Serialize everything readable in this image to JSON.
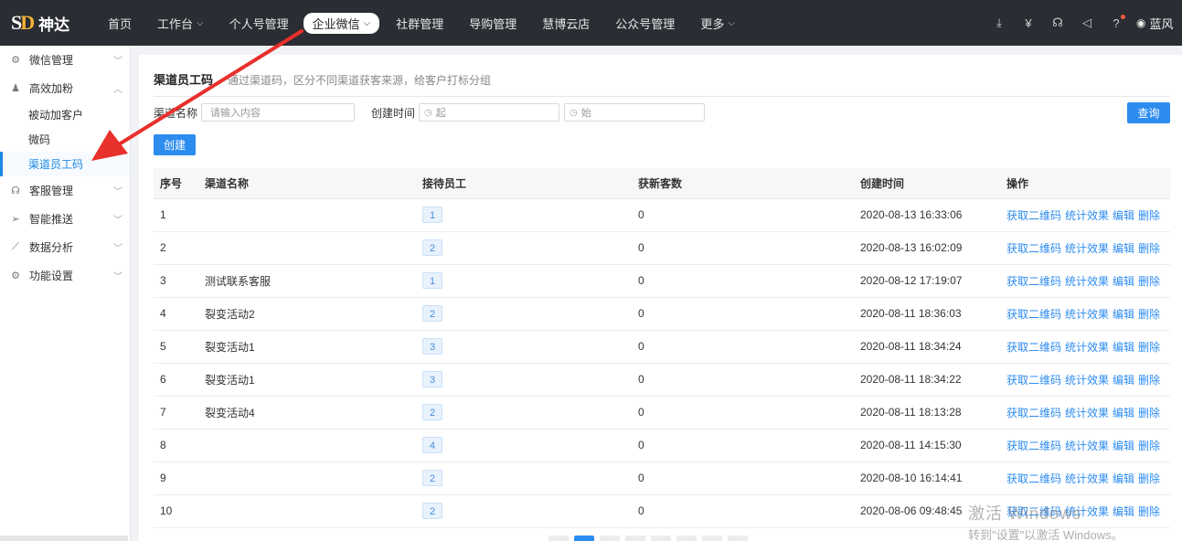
{
  "brand": {
    "mark_s": "S",
    "mark_d": "D",
    "name": "神达"
  },
  "nav": [
    {
      "label": "首页",
      "has_menu": false,
      "active": false
    },
    {
      "label": "工作台",
      "has_menu": true,
      "active": false
    },
    {
      "label": "个人号管理",
      "has_menu": false,
      "active": false
    },
    {
      "label": "企业微信",
      "has_menu": true,
      "active": true
    },
    {
      "label": "社群管理",
      "has_menu": false,
      "active": false
    },
    {
      "label": "导购管理",
      "has_menu": false,
      "active": false
    },
    {
      "label": "慧博云店",
      "has_menu": false,
      "active": false
    },
    {
      "label": "公众号管理",
      "has_menu": false,
      "active": false
    },
    {
      "label": "更多",
      "has_menu": true,
      "active": false
    }
  ],
  "user": {
    "name": "蓝风"
  },
  "sidebar": {
    "groups": [
      {
        "label": "微信管理",
        "icon": "gears-icon",
        "expanded": false,
        "items": []
      },
      {
        "label": "高效加粉",
        "icon": "person-icon",
        "expanded": true,
        "items": [
          {
            "label": "被动加客户",
            "active": false
          },
          {
            "label": "微码",
            "active": false
          },
          {
            "label": "渠道员工码",
            "active": true
          }
        ]
      },
      {
        "label": "客服管理",
        "icon": "headset-icon",
        "expanded": false,
        "items": []
      },
      {
        "label": "智能推送",
        "icon": "send-icon",
        "expanded": false,
        "items": []
      },
      {
        "label": "数据分析",
        "icon": "chart-icon",
        "expanded": false,
        "items": []
      },
      {
        "label": "功能设置",
        "icon": "gears-icon",
        "expanded": false,
        "items": []
      }
    ]
  },
  "page": {
    "title": "渠道员工码",
    "description": "通过渠道码，区分不同渠道获客来源，给客户打标分组"
  },
  "filter": {
    "name_label": "渠道名称",
    "name_placeholder": "请输入内容",
    "time_label": "创建时间",
    "start_placeholder": "起",
    "end_placeholder": "始",
    "query_button": "查询",
    "create_button": "创建"
  },
  "table": {
    "columns": [
      "序号",
      "渠道名称",
      "接待员工",
      "获新客数",
      "创建时间",
      "操作"
    ],
    "actions": [
      "获取二维码",
      "统计效果",
      "编辑",
      "删除"
    ],
    "rows": [
      {
        "index": "1",
        "name": "",
        "staff": "1",
        "new_customers": "0",
        "created": "2020-08-13 16:33:06"
      },
      {
        "index": "2",
        "name": "",
        "staff": "2",
        "new_customers": "0",
        "created": "2020-08-13 16:02:09"
      },
      {
        "index": "3",
        "name": "测试联系客服",
        "staff": "1",
        "new_customers": "0",
        "created": "2020-08-12 17:19:07"
      },
      {
        "index": "4",
        "name": "裂变活动2",
        "staff": "2",
        "new_customers": "0",
        "created": "2020-08-11 18:36:03"
      },
      {
        "index": "5",
        "name": "裂变活动1",
        "staff": "3",
        "new_customers": "0",
        "created": "2020-08-11 18:34:24"
      },
      {
        "index": "6",
        "name": "裂变活动1",
        "staff": "3",
        "new_customers": "0",
        "created": "2020-08-11 18:34:22"
      },
      {
        "index": "7",
        "name": "裂变活动4",
        "staff": "2",
        "new_customers": "0",
        "created": "2020-08-11 18:13:28"
      },
      {
        "index": "8",
        "name": "",
        "staff": "4",
        "new_customers": "0",
        "created": "2020-08-11 14:15:30"
      },
      {
        "index": "9",
        "name": "",
        "staff": "2",
        "new_customers": "0",
        "created": "2020-08-10 16:14:41"
      },
      {
        "index": "10",
        "name": "",
        "staff": "2",
        "new_customers": "0",
        "created": "2020-08-06 09:48:45"
      }
    ]
  },
  "watermark": {
    "line1": "激活 Windows",
    "line2": "转到\"设置\"以激活 Windows。"
  },
  "colors": {
    "accent": "#2d8cf0",
    "topbar": "#2a2d33",
    "annotation": "#e8302c"
  }
}
